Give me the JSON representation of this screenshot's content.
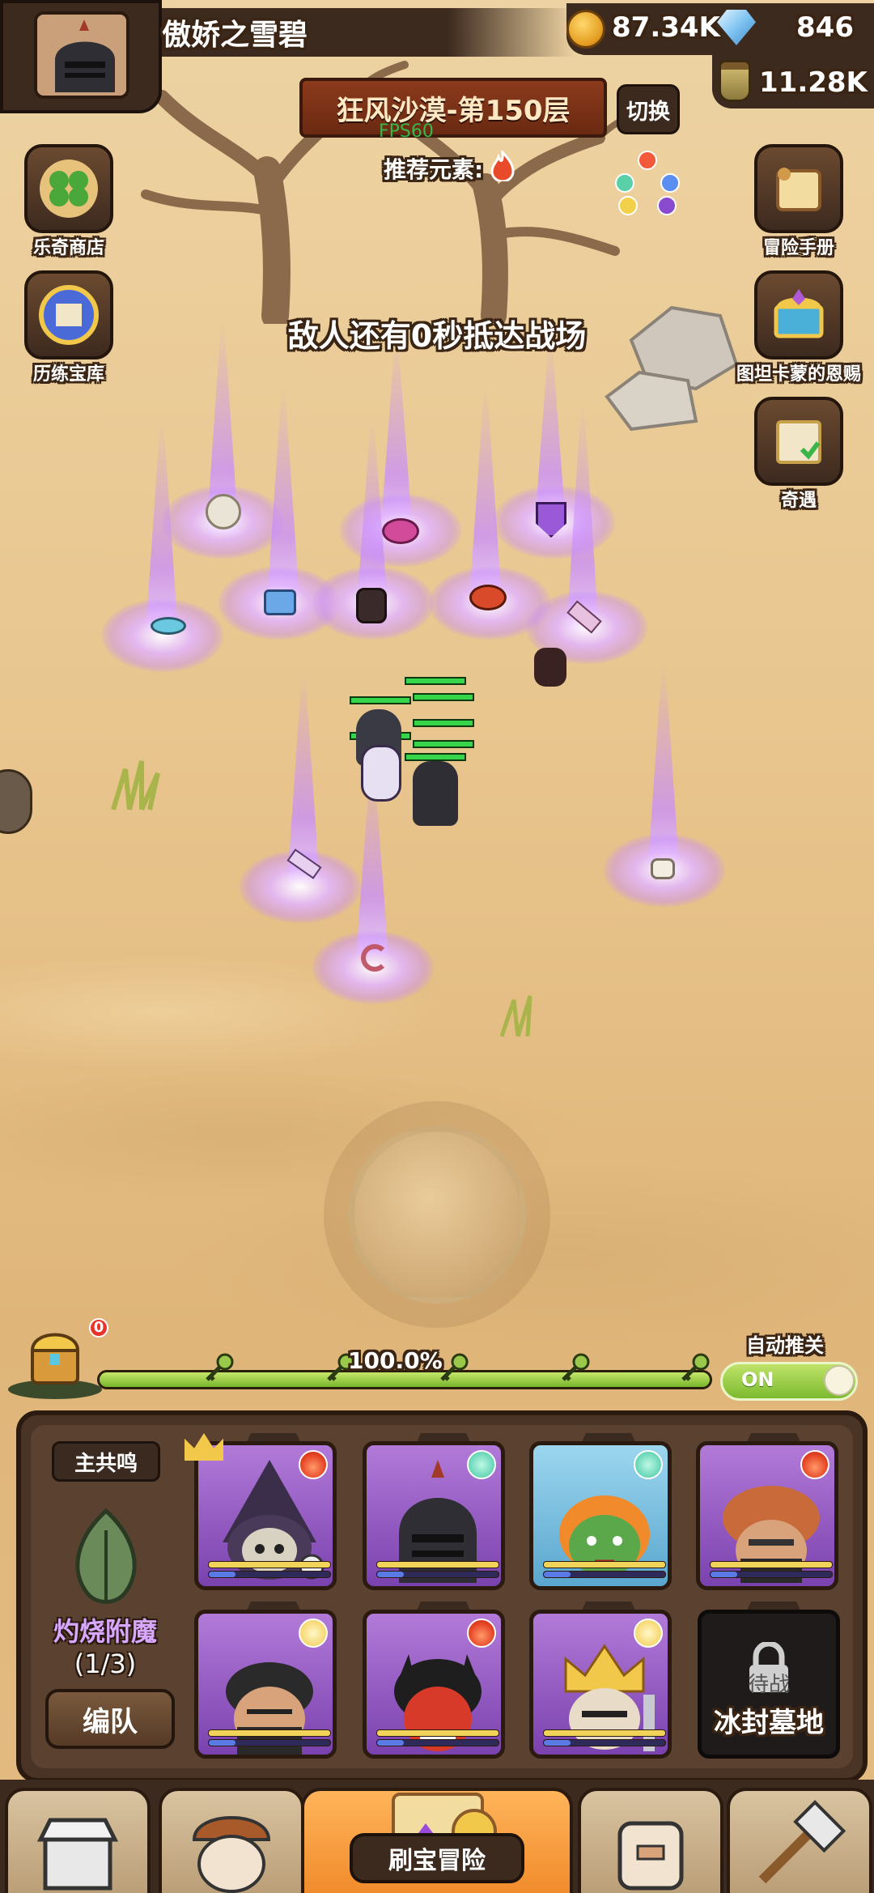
{
  "player": {
    "name": "傲娇之雪碧"
  },
  "resources": {
    "gold": "87.34K",
    "gems": "846",
    "elixir": "11.28K"
  },
  "stage": {
    "title": "狂风沙漠-第150层",
    "switch_label": "切换",
    "fps": "FPS60",
    "recommended_label": "推荐元素:"
  },
  "left_menu": [
    {
      "label": "乐奇商店",
      "icon": "clover-icon"
    },
    {
      "label": "历练宝库",
      "icon": "treasure-vault-icon"
    }
  ],
  "right_menu": [
    {
      "label": "冒险手册",
      "icon": "scroll-icon"
    },
    {
      "label": "图坦卡蒙的恩赐",
      "icon": "chest-icon"
    },
    {
      "label": "奇遇",
      "icon": "map-icon"
    }
  ],
  "wave_message": "敌人还有0秒抵达战场",
  "progress": {
    "chest_count": "0",
    "percent_text": "100.0%",
    "fill_fraction": 1.0,
    "auto_label": "自动推关",
    "toggle_text": "ON"
  },
  "team": {
    "resonance_label": "主共鸣",
    "enchant_name": "灼烧附魔",
    "enchant_count": "(1/3)",
    "formation_button": "编队",
    "locked_slot_label": "冰封墓地",
    "locked_slot_ghost": "待战",
    "heroes": [
      {
        "name": "skull-wizard",
        "element": "fire",
        "rarity": "purple"
      },
      {
        "name": "iron-knight",
        "element": "wind",
        "rarity": "purple"
      },
      {
        "name": "goblin-girl",
        "element": "wind",
        "rarity": "blue"
      },
      {
        "name": "turban-assassin",
        "element": "fire",
        "rarity": "purple"
      },
      {
        "name": "masked-rogue",
        "element": "light",
        "rarity": "purple"
      },
      {
        "name": "red-demon",
        "element": "fire",
        "rarity": "purple"
      },
      {
        "name": "crowned-king",
        "element": "light",
        "rarity": "purple"
      }
    ]
  },
  "nav": {
    "main_label": "刷宝冒险",
    "tabs": [
      "shop-icon",
      "hero-icon",
      "adventure-icon",
      "backpack-icon",
      "forge-icon"
    ]
  }
}
